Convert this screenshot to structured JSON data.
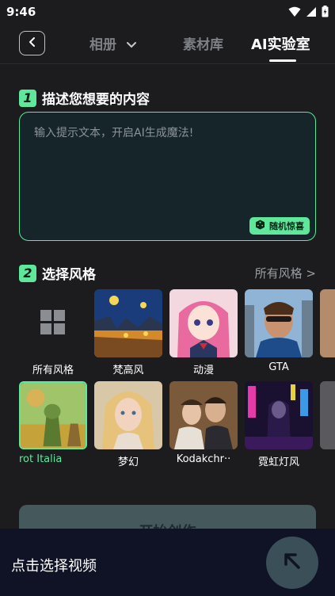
{
  "status": {
    "time": "9:46"
  },
  "nav": {
    "tabs": [
      {
        "label": "相册"
      },
      {
        "label": "素材库"
      },
      {
        "label": "AI实验室"
      }
    ]
  },
  "section1": {
    "num": "1",
    "title": "描述您想要的内容",
    "placeholder": "输入提示文本，开启AI生成魔法!",
    "random_label": "随机惊喜"
  },
  "section2": {
    "num": "2",
    "title": "选择风格",
    "all_link": "所有风格 >"
  },
  "styles_row1": [
    {
      "label": "所有风格"
    },
    {
      "label": "梵高风"
    },
    {
      "label": "动漫"
    },
    {
      "label": "GTA"
    }
  ],
  "styles_row2": [
    {
      "label": "rot      Italia"
    },
    {
      "label": "梦幻"
    },
    {
      "label": "Kodakchr··"
    },
    {
      "label": "霓虹灯风"
    }
  ],
  "start_button": {
    "label": "开始创作"
  },
  "bottom": {
    "label": "点击选择视频"
  },
  "colors": {
    "accent": "#5fe79c",
    "background": "#1c1c1f"
  }
}
